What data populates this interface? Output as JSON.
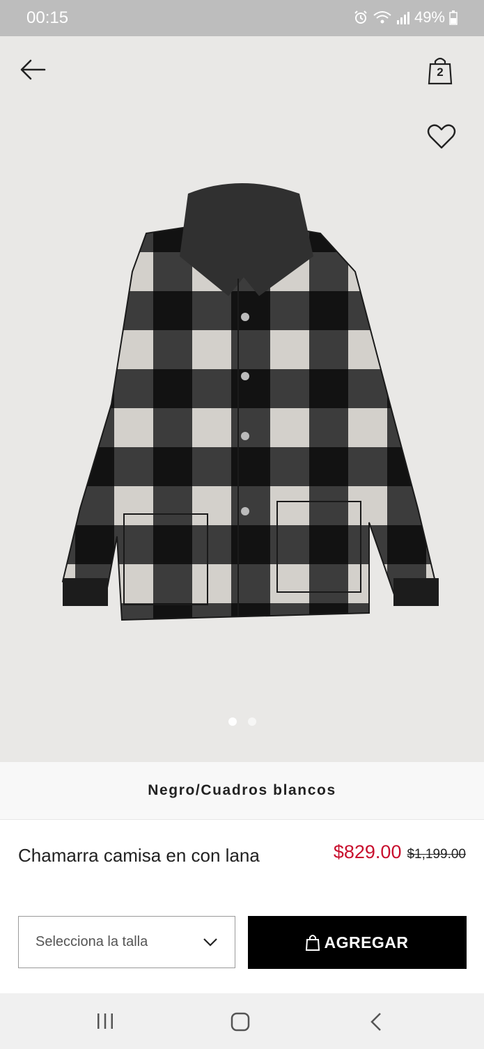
{
  "status_bar": {
    "time": "00:15",
    "battery": "49%"
  },
  "header": {
    "bag_count": "2"
  },
  "product": {
    "color_name": "Negro/Cuadros blancos",
    "name": "Chamarra camisa en con lana",
    "price_sale": "$829.00",
    "price_original": "$1,199.00",
    "size_placeholder": "Selecciona la talla",
    "add_button": "AGREGAR"
  },
  "gallery": {
    "image_count": 2,
    "active_index": 0
  },
  "colors": {
    "sale": "#c8102e",
    "button": "#000000",
    "hero_bg": "#e9e8e6"
  },
  "icons": [
    "arrow-left-icon",
    "shopping-bag-icon",
    "heart-icon",
    "chevron-down-icon",
    "recent-apps-icon",
    "home-icon",
    "back-icon"
  ]
}
